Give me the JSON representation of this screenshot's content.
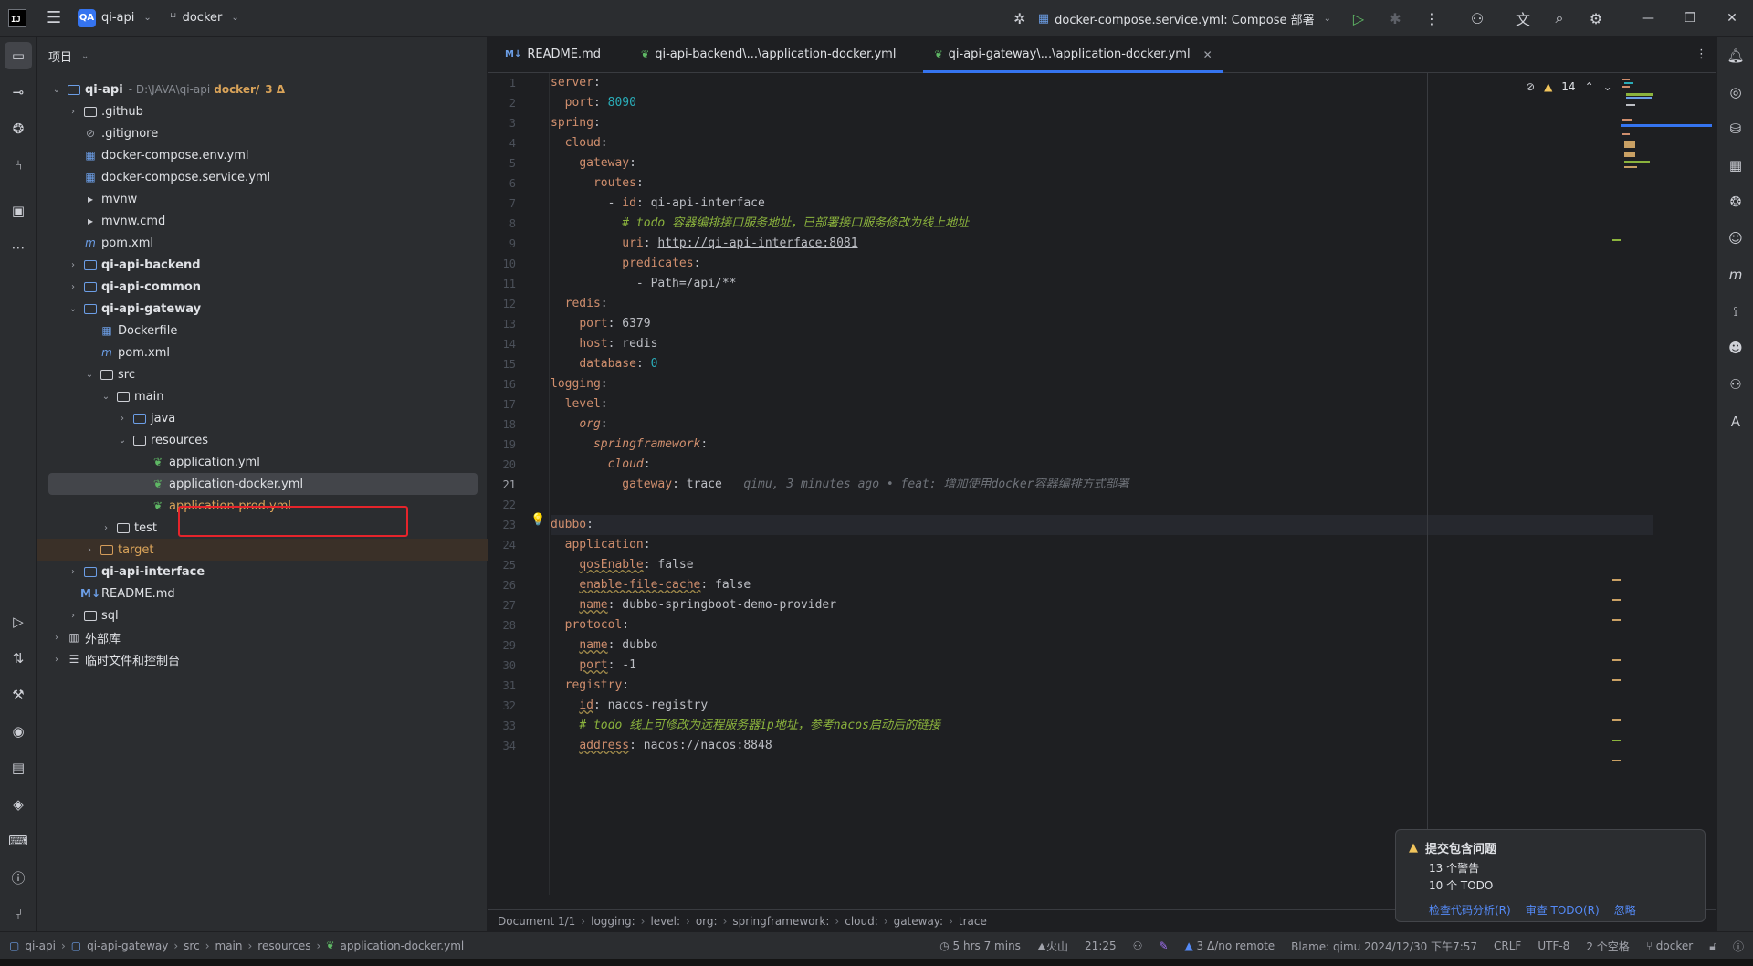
{
  "titlebar": {
    "project_badge": "QA",
    "project_name": "qi-api",
    "branch": "docker",
    "run_config": "docker-compose.service.yml: Compose 部署"
  },
  "project_panel": {
    "header": "项目",
    "root_name": "qi-api",
    "root_path": "- D:\\JAVA\\qi-api",
    "root_branch": "docker/",
    "root_changes": "3 Δ",
    "items": [
      {
        "label": ".github"
      },
      {
        "label": ".gitignore"
      },
      {
        "label": "docker-compose.env.yml"
      },
      {
        "label": "docker-compose.service.yml"
      },
      {
        "label": "mvnw"
      },
      {
        "label": "mvnw.cmd"
      },
      {
        "label": "pom.xml"
      },
      {
        "label": "qi-api-backend"
      },
      {
        "label": "qi-api-common"
      },
      {
        "label": "qi-api-gateway"
      },
      {
        "label": "Dockerfile"
      },
      {
        "label": "pom.xml"
      },
      {
        "label": "src"
      },
      {
        "label": "main"
      },
      {
        "label": "java"
      },
      {
        "label": "resources"
      },
      {
        "label": "application.yml"
      },
      {
        "label": "application-docker.yml"
      },
      {
        "label": "application-prod.yml"
      },
      {
        "label": "test"
      },
      {
        "label": "target"
      },
      {
        "label": "qi-api-interface"
      },
      {
        "label": "README.md"
      },
      {
        "label": "sql"
      },
      {
        "label": "外部库"
      },
      {
        "label": "临时文件和控制台"
      }
    ]
  },
  "tabs": [
    {
      "label": "README.md",
      "icon": "M↓"
    },
    {
      "label": "qi-api-backend\\...\\application-docker.yml"
    },
    {
      "label": "qi-api-gateway\\...\\application-docker.yml"
    }
  ],
  "editor": {
    "warning_count": "14",
    "lines": [
      "1",
      "2",
      "3",
      "4",
      "5",
      "6",
      "7",
      "8",
      "9",
      "10",
      "11",
      "12",
      "13",
      "14",
      "15",
      "16",
      "17",
      "18",
      "19",
      "20",
      "21",
      "22",
      "23",
      "24",
      "25",
      "26",
      "27",
      "28",
      "29",
      "30",
      "31",
      "32",
      "33",
      "34"
    ],
    "code": {
      "l1_k": "server",
      "l2_k": "port",
      "l2_v": "8090",
      "l3_k": "spring",
      "l4_k": "cloud",
      "l5_k": "gateway",
      "l6_k": "routes",
      "l7_k": "id",
      "l7_v": "qi-api-interface",
      "l8_todo": "# todo",
      "l8_c": " 容器编排接口服务地址，已部署接口服务修改为线上地址",
      "l9_k": "uri",
      "l9_v": "http://qi-api-interface:8081",
      "l10_k": "predicates",
      "l11_v": "- Path=/api/**",
      "l12_k": "redis",
      "l13_k": "port",
      "l13_v": "6379",
      "l14_k": "host",
      "l14_v": "redis",
      "l15_k": "database",
      "l15_v": "0",
      "l16_k": "logging",
      "l17_k": "level",
      "l18_k": "org",
      "l19_k": "springframework",
      "l20_k": "cloud",
      "l21_k": "gateway",
      "l21_v": "trace",
      "l21_blame": "qimu, 3 minutes ago • feat: 增加使用docker容器编排方式部署",
      "l23_k": "dubbo",
      "l24_k": "application",
      "l25_k": "qosEnable",
      "l25_v": "false",
      "l26_k": "enable-file-cache",
      "l26_v": "false",
      "l27_k": "name",
      "l27_v": "dubbo-springboot-demo-provider",
      "l28_k": "protocol",
      "l29_k": "name",
      "l29_v": "dubbo",
      "l30_k": "port",
      "l30_v": "-1",
      "l31_k": "registry",
      "l32_k": "id",
      "l32_v": "nacos-registry",
      "l33_todo": "# todo",
      "l33_c": " 线上可修改为远程服务器ip地址，参考nacos启动后的链接",
      "l34_k": "address",
      "l34_v": "nacos://nacos:8848"
    },
    "breadcrumb": [
      "Document 1/1",
      "logging:",
      "level:",
      "org:",
      "springframework:",
      "cloud:",
      "gateway:",
      "trace"
    ]
  },
  "notification": {
    "title": "提交包含问题",
    "warnings": "13 个警告",
    "todos": "10 个 TODO",
    "action1": "检查代码分析(R)",
    "action2": "审查 TODO(R)",
    "action3": "忽略"
  },
  "statusbar": {
    "crumbs": [
      "qi-api",
      "qi-api-gateway",
      "src",
      "main",
      "resources",
      "application-docker.yml"
    ],
    "time_tracked": "5 hrs 7 mins",
    "weather": "火山",
    "position": "21:25",
    "vcs": "3 Δ/no remote",
    "blame": "Blame: qimu 2024/12/30 下午7:57",
    "line_sep": "CRLF",
    "encoding": "UTF-8",
    "indent": "2 个空格",
    "branch": "docker"
  }
}
